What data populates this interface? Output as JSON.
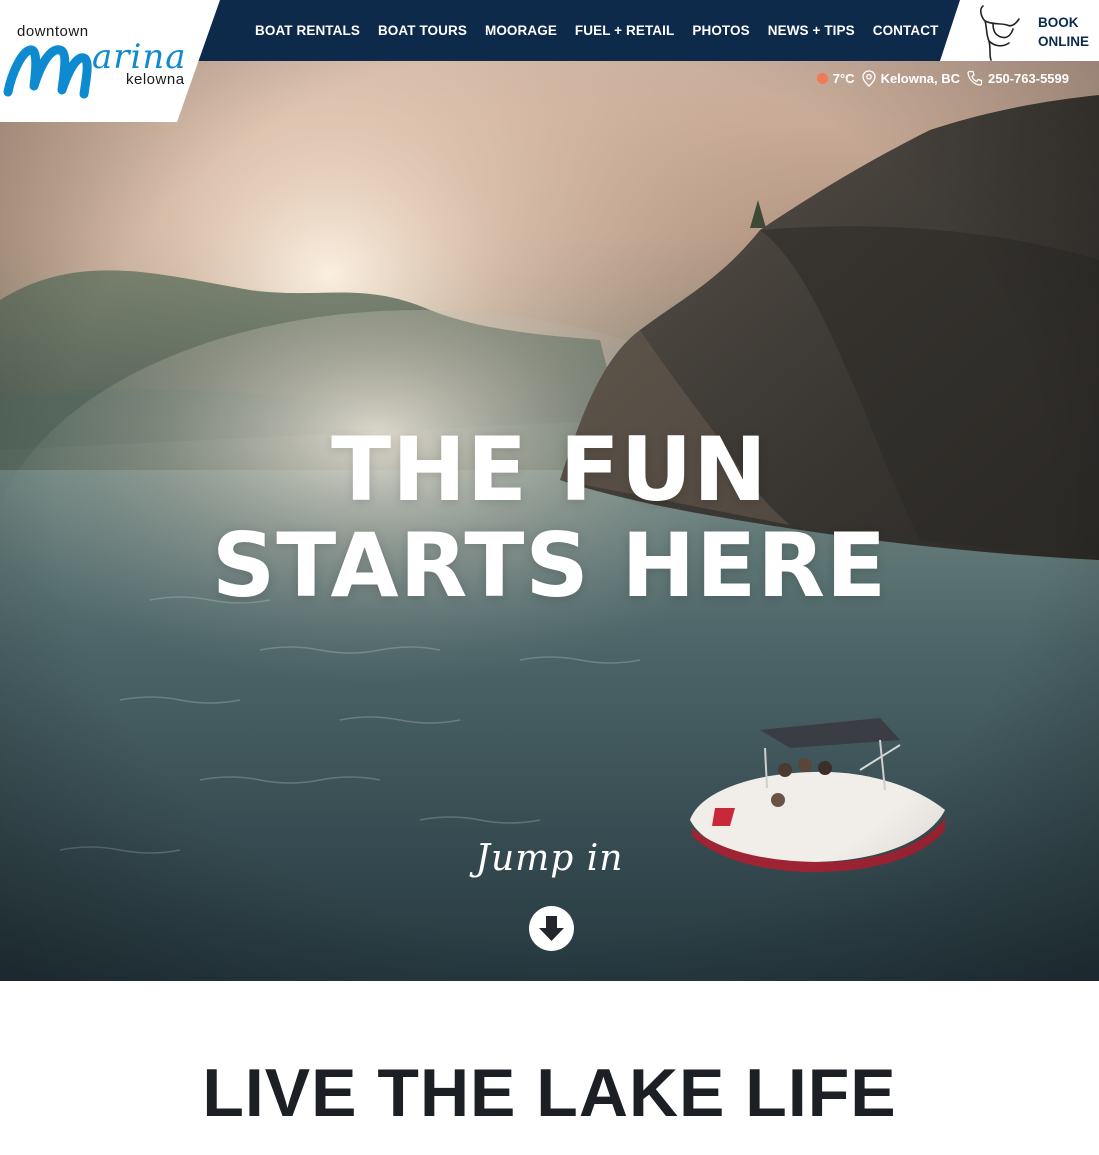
{
  "brand": {
    "logo_top": "downtown",
    "logo_main": "marina",
    "logo_bottom": "kelowna",
    "accent_color": "#0e8ad0",
    "nav_color": "#0e2a4a"
  },
  "nav": {
    "items": [
      {
        "label": "BOAT RENTALS"
      },
      {
        "label": "BOAT TOURS"
      },
      {
        "label": "MOORAGE"
      },
      {
        "label": "FUEL + RETAIL"
      },
      {
        "label": "PHOTOS"
      },
      {
        "label": "NEWS + TIPS"
      },
      {
        "label": "CONTACT"
      }
    ],
    "book": {
      "line1": "BOOK",
      "line2": "ONLINE",
      "icon": "shaka-hand-icon"
    }
  },
  "info": {
    "temperature": "7°C",
    "temperature_dot_color": "#f07a55",
    "location": "Kelowna, BC",
    "location_icon": "map-pin-icon",
    "phone": "250-763-5599",
    "phone_icon": "phone-icon"
  },
  "hero": {
    "headline_line1": "THE FUN",
    "headline_line2": "STARTS HERE",
    "tagline": "Jump in",
    "scroll_icon": "arrow-down-circle-icon"
  },
  "section": {
    "title": "LIVE THE LAKE LIFE"
  }
}
